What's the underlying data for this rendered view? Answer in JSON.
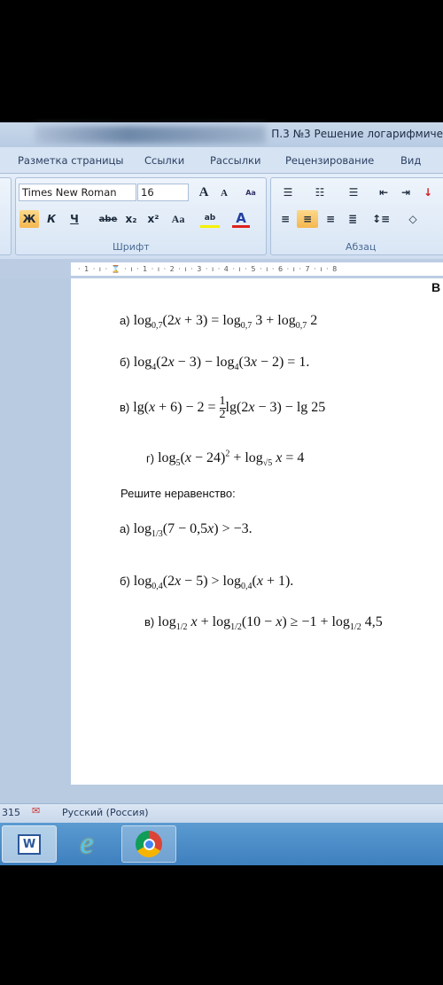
{
  "window": {
    "title": "П.3 №3 Решение логарифмиче"
  },
  "tabs": [
    "Разметка страницы",
    "Ссылки",
    "Рассылки",
    "Рецензирование",
    "Вид"
  ],
  "ribbon": {
    "font_name": "Times New Roman",
    "font_size": "16",
    "grow_font": "A",
    "shrink_font": "A",
    "clear_format": "Aa",
    "bold": "Ж",
    "italic": "К",
    "underline": "Ч",
    "strike": "abe",
    "subscript": "x₂",
    "superscript": "x²",
    "change_case": "Aa",
    "highlight": "ab",
    "font_color": "A",
    "font_group": "Шрифт",
    "paragraph_group": "Абзац",
    "font_color_hex": "#e0201c",
    "highlight_hex": "#f5f200"
  },
  "ruler": "· 1 · ı · ⌛ · ı · 1 · ı · 2 · ı · 3 · ı · 4 · ı · 5 · ı · 6 · ı · 7 · ı · 8",
  "document": {
    "corner_letter": "В",
    "equations": [
      {
        "label": "а)",
        "text": "log<sub>0,7</sub>(2<i>x</i> + 3) = log<sub>0,7</sub> 3 + log<sub>0,7</sub> 2"
      },
      {
        "label": "б)",
        "text": "log<sub>4</sub>(2<i>x</i> − 3) − log<sub>4</sub>(3<i>x</i> − 2) = 1."
      },
      {
        "label": "в)",
        "text": "lg(<i>x</i> + 6) − 2 = <span class=\"frac\"><span class=\"n\">1</span><span>2</span></span>lg(2<i>x</i> − 3) − lg 25"
      },
      {
        "label": "г)",
        "text": "log<sub>5</sub>(<i>x</i> − 24)<sup>2</sup> + log<sub>√5</sub> <i>x</i> = 4"
      }
    ],
    "inequality_heading": "Решите неравенство:",
    "inequalities": [
      {
        "label": "а)",
        "text": "log<sub>1/3</sub>(7 − 0,5<i>x</i>) &gt; −3."
      },
      {
        "label": "б)",
        "text": "log<sub>0,4</sub>(2<i>x</i> − 5) &gt; log<sub>0,4</sub>(<i>x</i> + 1)."
      },
      {
        "label": "в)",
        "text": "log<sub>1/2</sub> <i>x</i> + log<sub>1/2</sub>(10 − <i>x</i>) ≥ −1 + log<sub>1/2</sub> 4,5"
      }
    ]
  },
  "status": {
    "word_count": "315",
    "language": "Русский (Россия)"
  },
  "taskbar": [
    "word-icon",
    "internet-explorer-icon",
    "chrome-icon"
  ]
}
